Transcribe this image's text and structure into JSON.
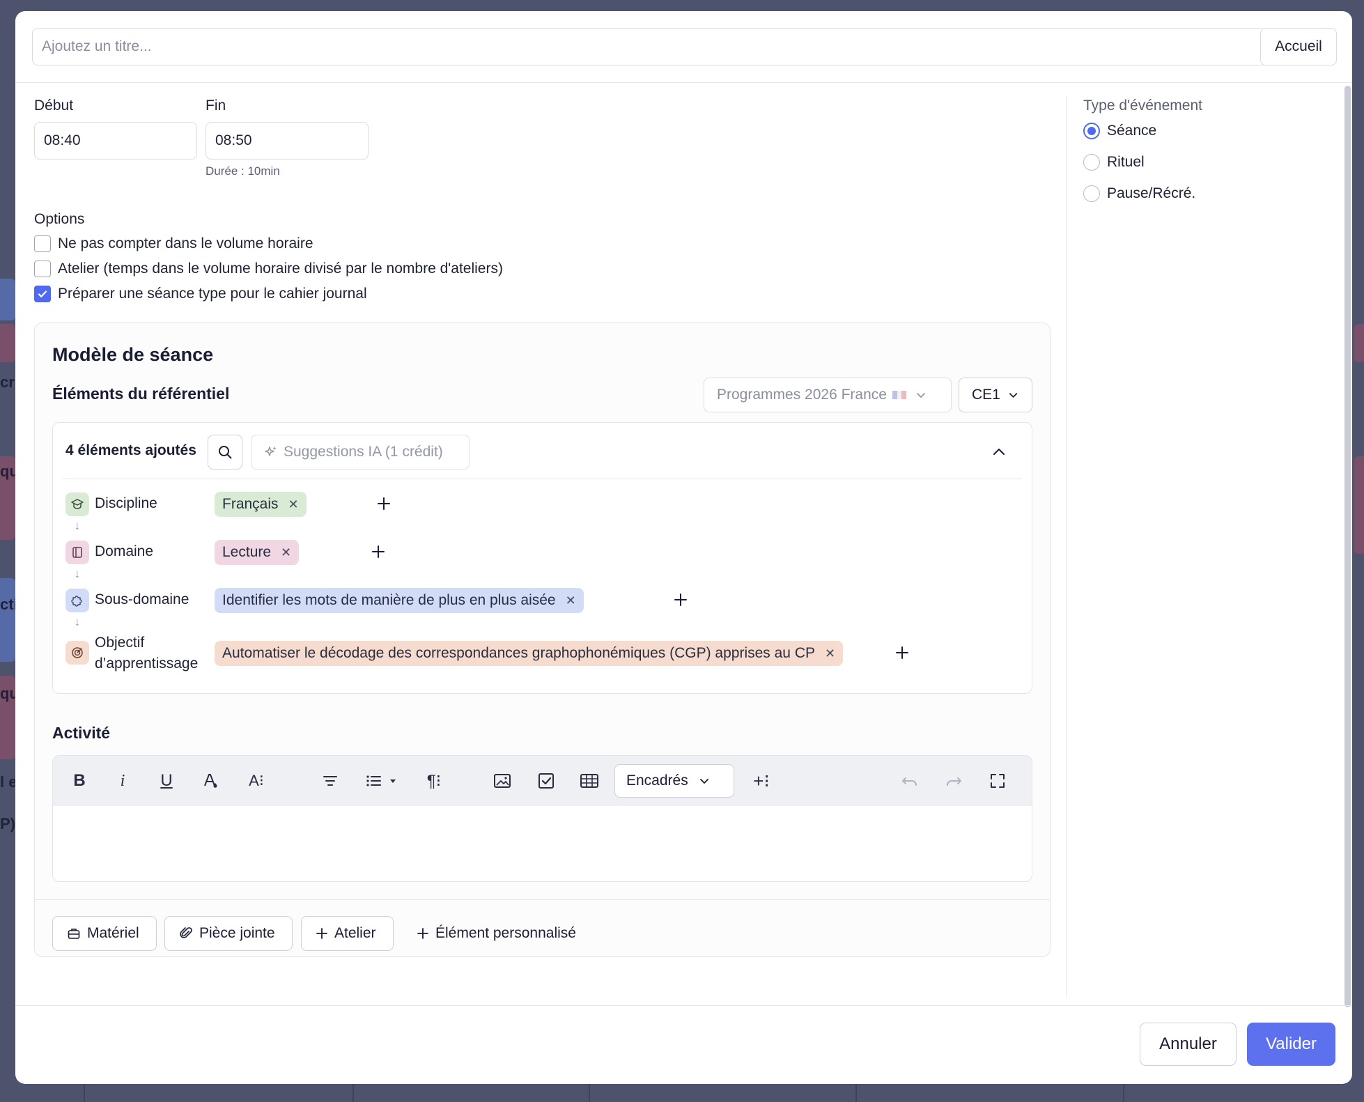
{
  "background": {
    "fragments": [
      "cri",
      "que",
      "cti",
      "que",
      "l e",
      "P)"
    ]
  },
  "title_bar": {
    "title_placeholder": "Ajoutez un titre...",
    "title_value": "",
    "home_label": "Accueil"
  },
  "schedule": {
    "start_label": "Début",
    "start_value": "08:40",
    "end_label": "Fin",
    "end_value": "08:50",
    "duration_text": "Durée : 10min"
  },
  "options": {
    "label": "Options",
    "items": [
      {
        "label": "Ne pas compter dans le volume horaire",
        "checked": false
      },
      {
        "label": "Atelier (temps dans le volume horaire divisé par le nombre d'ateliers)",
        "checked": false
      },
      {
        "label": "Préparer une séance type pour le cahier journal",
        "checked": true
      }
    ]
  },
  "event_type": {
    "label": "Type d'événement",
    "options": [
      {
        "label": "Séance",
        "selected": true
      },
      {
        "label": "Rituel",
        "selected": false
      },
      {
        "label": "Pause/Récré.",
        "selected": false
      }
    ]
  },
  "model": {
    "title": "Modèle de séance",
    "referential": {
      "title": "Éléments du référentiel",
      "program_select": "Programmes 2026 France",
      "level_select": "CE1",
      "count_label": "4 éléments ajoutés",
      "ai_button": "Suggestions IA (1 crédit)",
      "rows": [
        {
          "name": "Discipline",
          "icon": "graduation-cap-icon",
          "tag": "Français",
          "tag_color": "#d9ead5",
          "icon_bg": "#d9ead5"
        },
        {
          "name": "Domaine",
          "icon": "book-icon",
          "tag": "Lecture",
          "tag_color": "#f1d6e3",
          "icon_bg": "#f1d6e3"
        },
        {
          "name": "Sous-domaine",
          "icon": "puzzle-icon",
          "tag": "Identifier les mots de manière de plus en plus aisée",
          "tag_color": "#d3dcf7",
          "icon_bg": "#d3dcf7"
        },
        {
          "name": "Objectif d’apprentissage",
          "name_line1": "Objectif",
          "name_line2": "d’apprentissage",
          "icon": "target-icon",
          "tag": "Automatiser le décodage des correspondances graphophonémiques (CGP) apprises au CP",
          "tag_color": "#f5dccf",
          "icon_bg": "#f5dccf"
        }
      ]
    },
    "activity": {
      "title": "Activité",
      "boxes_select": "Encadrés",
      "content": ""
    },
    "footer_buttons": {
      "material": "Matériel",
      "attachment": "Pièce jointe",
      "workshop": "Atelier",
      "custom": "Élément personnalisé"
    }
  },
  "actions": {
    "cancel": "Annuler",
    "validate": "Valider"
  },
  "colors": {
    "accent": "#4f6af0",
    "primary_button": "#5d70ee"
  }
}
